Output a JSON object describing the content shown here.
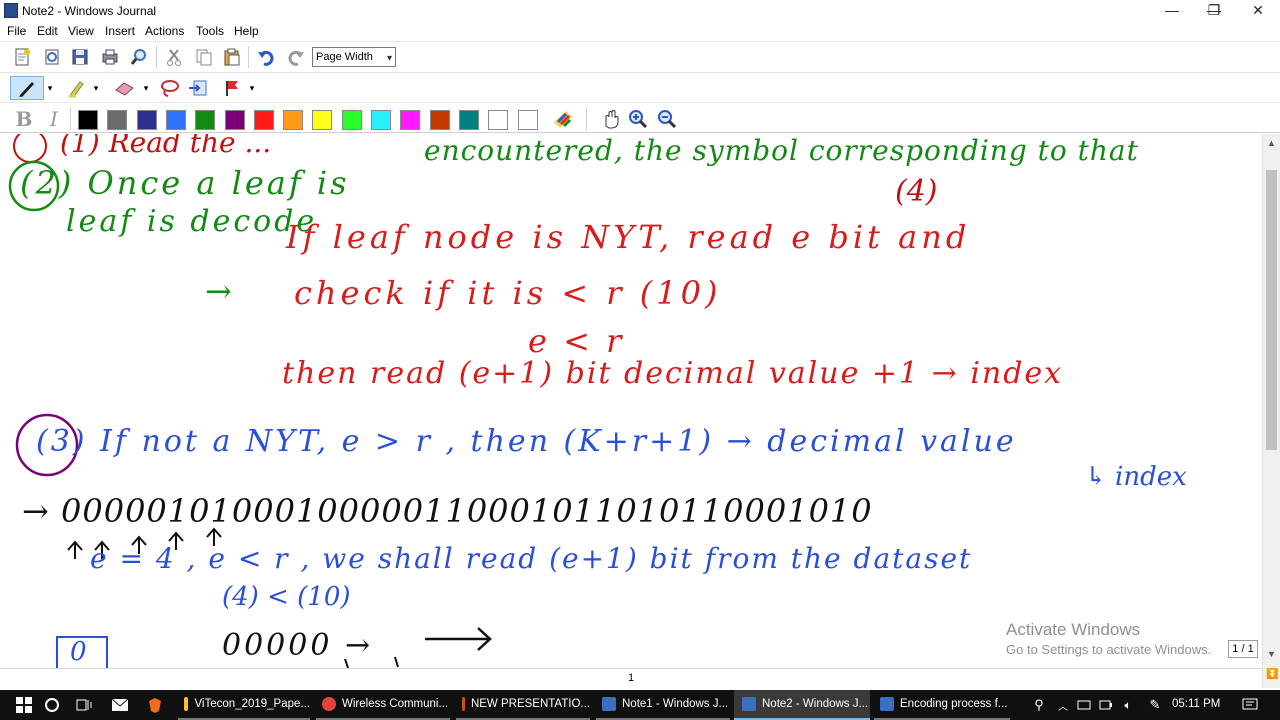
{
  "window": {
    "title": "Note2 - Windows Journal",
    "controls": {
      "minimize": "—",
      "maximize": "❐",
      "close": "✕"
    }
  },
  "menu": [
    "File",
    "Edit",
    "View",
    "Insert",
    "Actions",
    "Tools",
    "Help"
  ],
  "toolbar": {
    "zoom_value": "Page Width"
  },
  "format": {
    "bold": "B",
    "italic": "I"
  },
  "palette": [
    "#000000",
    "#6b6b6b",
    "#2f2f8f",
    "#2e73ff",
    "#138a13",
    "#7a007a",
    "#ff1a1a",
    "#ff9a1a",
    "#ffff1a",
    "#2bff2b",
    "#28f0ff",
    "#ff1aff",
    "#c43b00",
    "#008080",
    "#ffffff",
    "#ffffff"
  ],
  "note": {
    "lines": [
      {
        "text": "(1) Read the ...",
        "color": "#c01010"
      },
      {
        "text": "encountered, the symbol corresponding to that",
        "color": "#138a13"
      },
      {
        "text": "(2) Once a leaf is",
        "color": "#138a13"
      },
      {
        "text": "(4)",
        "color": "#c01010"
      },
      {
        "text": "leaf is decode",
        "color": "#138a13"
      },
      {
        "text": "If leaf node is NYT, read e bit and",
        "color": "#d81b1b"
      },
      {
        "text": "→",
        "color": "#138a13"
      },
      {
        "text": "check if it is < r (10)",
        "color": "#d81b1b"
      },
      {
        "text": "e < r",
        "color": "#d81b1b"
      },
      {
        "text": "then read (e+1) bit decimal value +1 → index",
        "color": "#d81b1b"
      },
      {
        "text": "(3) If not a NYT, e > r , then (K+r+1) → decimal value",
        "color": "#2a4fd8"
      },
      {
        "text": "↳ index",
        "color": "#2a4fd8"
      },
      {
        "text": "→ 00000101000100000110001011010110001010",
        "color": "#111111"
      },
      {
        "text": "↑↑↑↑↑",
        "color": "#111111"
      },
      {
        "text": "e = 4 , e < r , we shall read (e+1) bit from the dataset",
        "color": "#2a4fd8"
      },
      {
        "text": "(4) < (10)",
        "color": "#2a4fd8"
      },
      {
        "text": "0",
        "color": "#2a4fd8"
      },
      {
        "text": "00000 →",
        "color": "#111111"
      }
    ]
  },
  "status": {
    "page": "1",
    "page_box": "1 / 1"
  },
  "watermark": {
    "line1": "Activate Windows",
    "line2": "Go to Settings to activate Windows."
  },
  "taskbar": {
    "items": [
      {
        "label": "ViTecon_2019_Pape...",
        "color": "#f2c230"
      },
      {
        "label": "Wireless Communi...",
        "color": "#e2463a"
      },
      {
        "label": "NEW PRESENTATIO...",
        "color": "#d04a20"
      },
      {
        "label": "Note1 - Windows J...",
        "color": "#3a6fc2"
      },
      {
        "label": "Note2 - Windows J...",
        "color": "#3a6fc2"
      },
      {
        "label": "Encoding process f...",
        "color": "#3a6fc2"
      }
    ],
    "clock": "05:11 PM"
  }
}
